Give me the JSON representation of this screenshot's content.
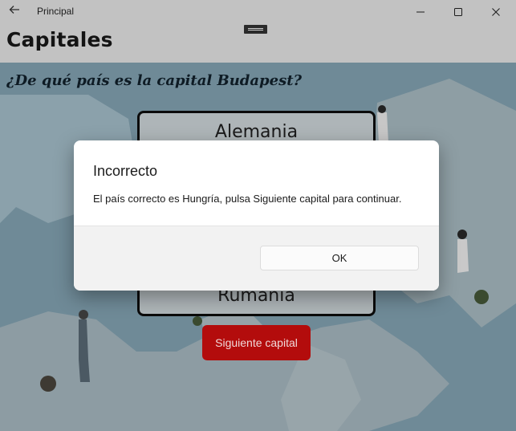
{
  "window": {
    "title": "Principal",
    "back_icon": "back-arrow-icon",
    "controls": [
      "minimize-icon",
      "maximize-icon",
      "close-icon"
    ]
  },
  "page": {
    "title": "Capitales"
  },
  "quiz": {
    "question": "¿De qué país es la capital Budapest?",
    "options": [
      "Alemania",
      "Rumania"
    ],
    "next_button": "Siguiente capital"
  },
  "dialog": {
    "title": "Incorrecto",
    "message": "El país correcto es Hungría, pulsa Siguiente capital para continuar.",
    "ok_button": "OK"
  },
  "colors": {
    "titlebar": "#c2c2c2",
    "next_button": "#b30c0c",
    "dialog_bg": "#ffffff",
    "dialog_footer": "#f2f2f2"
  }
}
